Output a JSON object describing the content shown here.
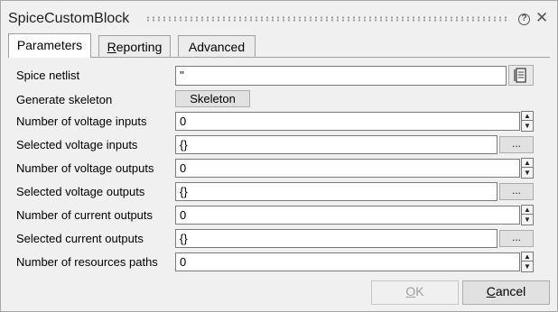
{
  "window": {
    "title": "SpiceCustomBlock",
    "help_glyph": "?",
    "close_glyph": "✕"
  },
  "tabs": [
    {
      "label": "Parameters"
    },
    {
      "label_ul": "R",
      "label_rest": "eporting"
    },
    {
      "label": "Advanced"
    }
  ],
  "form": {
    "spice_netlist": {
      "label": "Spice netlist",
      "value": "''"
    },
    "generate_skeleton": {
      "label": "Generate skeleton",
      "button": "Skeleton"
    },
    "num_voltage_inputs": {
      "label": "Number of voltage inputs",
      "value": "0"
    },
    "sel_voltage_inputs": {
      "label": "Selected voltage inputs",
      "value": "{}"
    },
    "num_voltage_outputs": {
      "label": "Number of voltage outputs",
      "value": "0"
    },
    "sel_voltage_outputs": {
      "label": "Selected voltage outputs",
      "value": "{}"
    },
    "num_current_outputs": {
      "label": "Number of current outputs",
      "value": "0"
    },
    "sel_current_outputs": {
      "label": "Selected current outputs",
      "value": "{}"
    },
    "num_resource_paths": {
      "label": "Number of resources paths",
      "value": "0"
    },
    "browse_label": "...",
    "spin_up": "▲",
    "spin_down": "▼"
  },
  "buttons": {
    "ok_ul": "O",
    "ok_rest": "K",
    "cancel_ul": "C",
    "cancel_rest": "ancel"
  },
  "icons": {
    "netlist_editor": "document-edit-icon",
    "help": "help-icon",
    "close": "close-icon"
  }
}
